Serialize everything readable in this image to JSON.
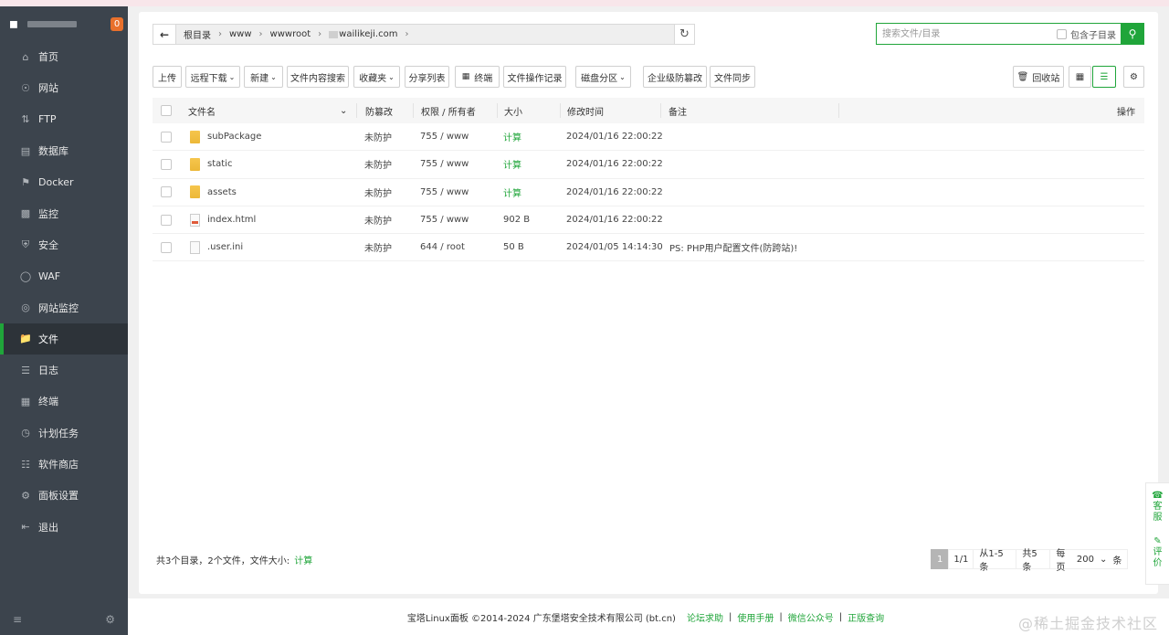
{
  "sidebar": {
    "badge": "0",
    "items": [
      {
        "label": "首页",
        "icon": "home-icon"
      },
      {
        "label": "网站",
        "icon": "globe-icon"
      },
      {
        "label": "FTP",
        "icon": "ftp-icon"
      },
      {
        "label": "数据库",
        "icon": "database-icon"
      },
      {
        "label": "Docker",
        "icon": "docker-icon"
      },
      {
        "label": "监控",
        "icon": "monitor-icon"
      },
      {
        "label": "安全",
        "icon": "shield-icon"
      },
      {
        "label": "WAF",
        "icon": "waf-icon"
      },
      {
        "label": "网站监控",
        "icon": "site-monitor-icon"
      },
      {
        "label": "文件",
        "icon": "folder-icon",
        "active": true
      },
      {
        "label": "日志",
        "icon": "log-icon"
      },
      {
        "label": "终端",
        "icon": "terminal-icon"
      },
      {
        "label": "计划任务",
        "icon": "cron-icon"
      },
      {
        "label": "软件商店",
        "icon": "store-icon"
      },
      {
        "label": "面板设置",
        "icon": "settings-icon"
      },
      {
        "label": "退出",
        "icon": "logout-icon"
      }
    ]
  },
  "path": {
    "crumbs": [
      "根目录",
      "www",
      "wwwroot",
      "wailikeji.com"
    ]
  },
  "search": {
    "placeholder": "搜索文件/目录",
    "include_sub_label": "包含子目录"
  },
  "toolbar": {
    "upload": "上传",
    "remote_download": "远程下载",
    "new": "新建",
    "content_search": "文件内容搜索",
    "favorites": "收藏夹",
    "share_list": "分享列表",
    "terminal": "终端",
    "op_log": "文件操作记录",
    "disk_partition": "磁盘分区",
    "enterprise_tamper": "企业级防篡改",
    "file_sync": "文件同步",
    "recycle": "回收站"
  },
  "table": {
    "headers": {
      "name": "文件名",
      "tamper": "防篡改",
      "perm": "权限 / 所有者",
      "size": "大小",
      "mtime": "修改时间",
      "note": "备注",
      "ops": "操作"
    },
    "rows": [
      {
        "name": "subPackage",
        "type": "folder",
        "tamper": "未防护",
        "perm": "755 / www",
        "size": "计算",
        "mtime": "2024/01/16 22:00:22",
        "note": ""
      },
      {
        "name": "static",
        "type": "folder",
        "tamper": "未防护",
        "perm": "755 / www",
        "size": "计算",
        "mtime": "2024/01/16 22:00:22",
        "note": ""
      },
      {
        "name": "assets",
        "type": "folder",
        "tamper": "未防护",
        "perm": "755 / www",
        "size": "计算",
        "mtime": "2024/01/16 22:00:22",
        "note": ""
      },
      {
        "name": "index.html",
        "type": "html",
        "tamper": "未防护",
        "perm": "755 / www",
        "size": "902 B",
        "mtime": "2024/01/16 22:00:22",
        "note": ""
      },
      {
        "name": ".user.ini",
        "type": "file",
        "tamper": "未防护",
        "perm": "644 / root",
        "size": "50 B",
        "mtime": "2024/01/05 14:14:30",
        "note": "PS: PHP用户配置文件(防跨站)!"
      }
    ]
  },
  "summary": {
    "text": "共3个目录，2个文件，文件大小:",
    "calc": "计算"
  },
  "pager": {
    "current": "1",
    "pages": "1/1",
    "range": "从1-5条",
    "total": "共5条",
    "per_page_label": "每页",
    "per_page": "200",
    "unit": "条"
  },
  "footer": {
    "copyright": "宝塔Linux面板 ©2014-2024 广东堡塔安全技术有限公司 (bt.cn)",
    "links": [
      "论坛求助",
      "使用手册",
      "微信公众号",
      "正版查询"
    ]
  },
  "side_panel": {
    "service": "客服",
    "review": "评价"
  },
  "watermark": "@稀土掘金技术社区"
}
